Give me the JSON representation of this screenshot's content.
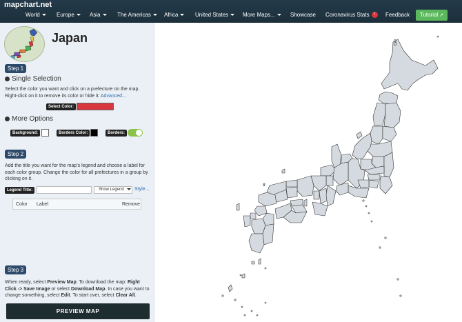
{
  "brand": "mapchart.net",
  "nav": {
    "world": "World",
    "europe": "Europe",
    "asia": "Asia",
    "americas": "The Americas",
    "africa": "Africa",
    "us": "United States",
    "more": "More Maps...",
    "showcase": "Showcase",
    "covid": "Coronavirus Stats",
    "covid_badge": "!",
    "feedback": "Feedback",
    "tutorial": "Tutorial"
  },
  "map_title": "Japan",
  "step1": {
    "badge": "Step 1",
    "single_selection": "Single Selection",
    "help": "Select the color you want and click on a prefecture on the map. Right-click on it to remove its color or hide it.",
    "advanced": "Advanced...",
    "select_color_label": "Select Color:",
    "select_color_value": "#d9363e",
    "more_options": "More Options",
    "background_label": "Background:",
    "borders_color_label": "Borders Color:",
    "borders_label": "Borders:",
    "background_color": "#ffffff",
    "borders_color": "#000000",
    "toggle_color": "#8bc34a"
  },
  "step2": {
    "badge": "Step 2",
    "help": "Add the title you want for the map's legend and choose a label for each color group. Change the color for all prefectures in a group by clicking on it.",
    "legend_title_label": "Legend Title:",
    "legend_title_value": "",
    "show_legend": "Show Legend",
    "style_link": "Style...",
    "col_color": "Color",
    "col_label": "Label",
    "col_remove": "Remove"
  },
  "step3": {
    "badge": "Step 3",
    "help_p1": "When ready, select ",
    "preview_map_bold": "Preview Map",
    "help_p2": ". To download the map: ",
    "right_click_bold": "Right Click ->",
    "save_image_bold": "Save Image",
    "help_p3": " or select ",
    "download_map_bold": "Download Map",
    "help_p4": ". In case you want to change something, select ",
    "edit_bold": "Edit",
    "help_p5": ". To start over, select ",
    "clear_all_bold": "Clear All",
    "help_p6": "."
  },
  "preview_button": "PREVIEW MAP",
  "colors": {
    "navbar": "#1f3340",
    "sidebar": "#eaf0f5",
    "step_badge": "#2d4a6b",
    "map_fill": "#d4dadf",
    "map_stroke": "#333333",
    "tutorial": "#5cb85c"
  }
}
